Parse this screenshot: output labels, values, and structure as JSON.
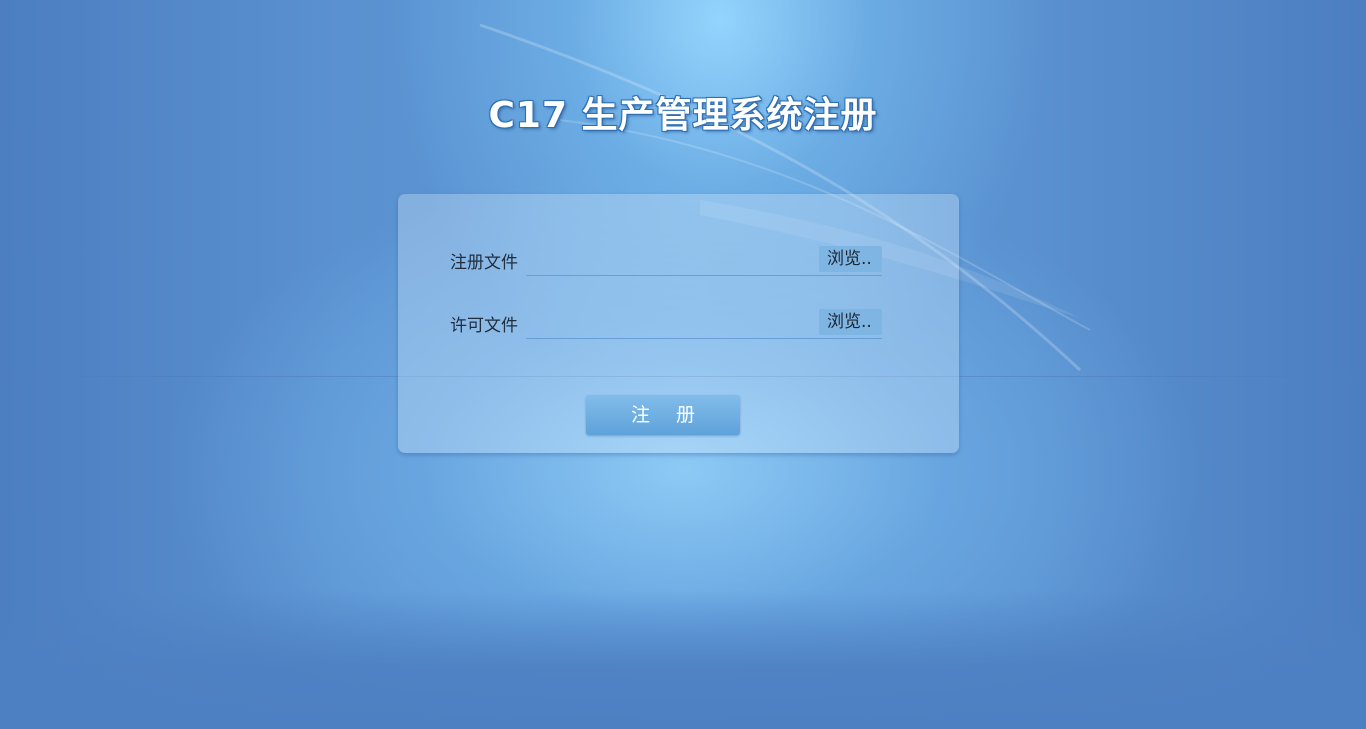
{
  "page": {
    "title": "C17 生产管理系统注册"
  },
  "form": {
    "registration_file": {
      "label": "注册文件",
      "browse_label": "浏览.."
    },
    "license_file": {
      "label": "许可文件",
      "browse_label": "浏览.."
    },
    "submit_label": "注 册"
  },
  "colors": {
    "background": "#4d80c2",
    "accent": "#5ea2da",
    "title_outline": "#2e6fb4"
  }
}
